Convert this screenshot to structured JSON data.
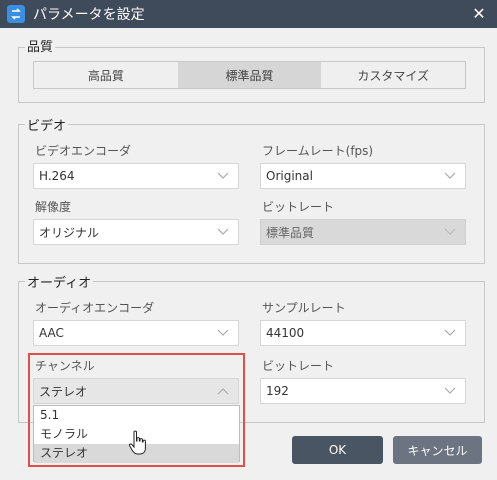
{
  "window": {
    "title": "パラメータを設定",
    "close_glyph": "✕"
  },
  "quality": {
    "label": "品質",
    "options": [
      "高品質",
      "標準品質",
      "カスタマイズ"
    ],
    "selected": "標準品質"
  },
  "video": {
    "label": "ビデオ",
    "encoder_label": "ビデオエンコーダ",
    "encoder_value": "H.264",
    "framerate_label": "フレームレート(fps)",
    "framerate_value": "Original",
    "resolution_label": "解像度",
    "resolution_value": "オリジナル",
    "bitrate_label": "ビットレート",
    "bitrate_value": "標準品質"
  },
  "audio": {
    "label": "オーディオ",
    "encoder_label": "オーディオエンコーダ",
    "encoder_value": "AAC",
    "samplerate_label": "サンプルレート",
    "samplerate_value": "44100",
    "channel_label": "チャンネル",
    "channel_value": "ステレオ",
    "channel_options": [
      "5.1",
      "モノラル",
      "ステレオ"
    ],
    "bitrate_label": "ビットレート",
    "bitrate_value": "192"
  },
  "buttons": {
    "ok": "OK",
    "cancel": "キャンセル"
  },
  "colors": {
    "titlebar": "#3f4a5a",
    "highlight": "#e0504b",
    "ok_button": "#4a5564",
    "cancel_button": "#6b7480"
  },
  "icons": {
    "app": "app-logo-icon",
    "close": "close-icon",
    "chevron": "chevron-down-icon",
    "cursor": "hand-cursor-icon"
  }
}
